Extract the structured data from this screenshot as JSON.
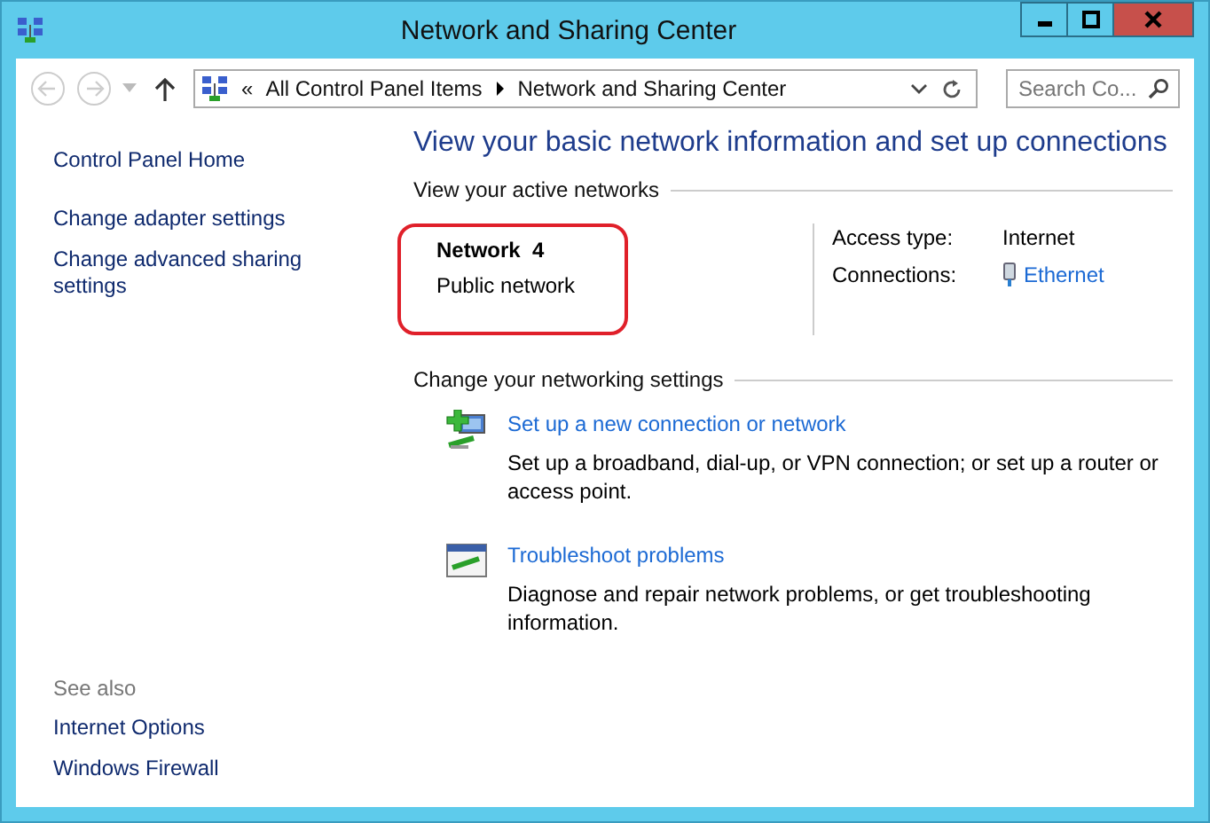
{
  "window": {
    "title": "Network and Sharing Center"
  },
  "navigation": {
    "back_disabled": true,
    "forward_disabled": true,
    "breadcrumb_prefix": "«",
    "breadcrumb": [
      "All Control Panel Items",
      "Network and Sharing Center"
    ],
    "search": {
      "placeholder": "Search Co..."
    }
  },
  "sidebar": {
    "items": [
      "Control Panel Home",
      "Change adapter settings",
      "Change advanced sharing settings"
    ],
    "see_also_title": "See also",
    "see_also": [
      "Internet Options",
      "Windows Firewall"
    ]
  },
  "main": {
    "heading": "View your basic network information and set up connections",
    "active_networks_title": "View your active networks",
    "network": {
      "name": "Network  4",
      "type": "Public network",
      "highlighted": true
    },
    "details": [
      {
        "label": "Access type:",
        "value": "Internet",
        "kind": "text"
      },
      {
        "label": "Connections:",
        "value": "Ethernet",
        "kind": "link"
      }
    ],
    "settings_title": "Change your networking settings",
    "tasks": [
      {
        "kind": "new-connection",
        "title": "Set up a new connection or network",
        "description": "Set up a broadband, dial-up, or VPN connection; or set up a router or access point."
      },
      {
        "kind": "troubleshoot",
        "title": "Troubleshoot problems",
        "description": "Diagnose and repair network problems, or get troubleshooting information."
      }
    ]
  }
}
